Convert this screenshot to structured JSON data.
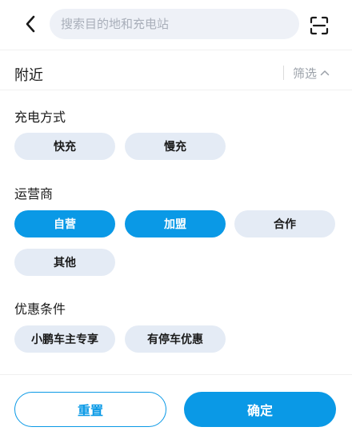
{
  "header": {
    "back_icon": "chevron-left-icon",
    "search_placeholder": "搜索目的地和充电站",
    "scan_icon": "scan-icon"
  },
  "nearby": {
    "label": "附近",
    "filter_label": "筛选",
    "filter_icon": "chevron-up-icon"
  },
  "sections": [
    {
      "title": "充电方式",
      "options": [
        {
          "label": "快充",
          "selected": false
        },
        {
          "label": "慢充",
          "selected": false
        }
      ]
    },
    {
      "title": "运营商",
      "options": [
        {
          "label": "自营",
          "selected": true
        },
        {
          "label": "加盟",
          "selected": true
        },
        {
          "label": "合作",
          "selected": false
        },
        {
          "label": "其他",
          "selected": false
        }
      ]
    },
    {
      "title": "优惠条件",
      "options": [
        {
          "label": "小鹏车主专享",
          "selected": false
        },
        {
          "label": "有停车优惠",
          "selected": false
        }
      ]
    }
  ],
  "footer": {
    "reset_label": "重置",
    "confirm_label": "确定"
  },
  "colors": {
    "accent": "#0a99e6",
    "chip_bg": "#e4ebf5",
    "search_bg": "#eef1f7"
  }
}
